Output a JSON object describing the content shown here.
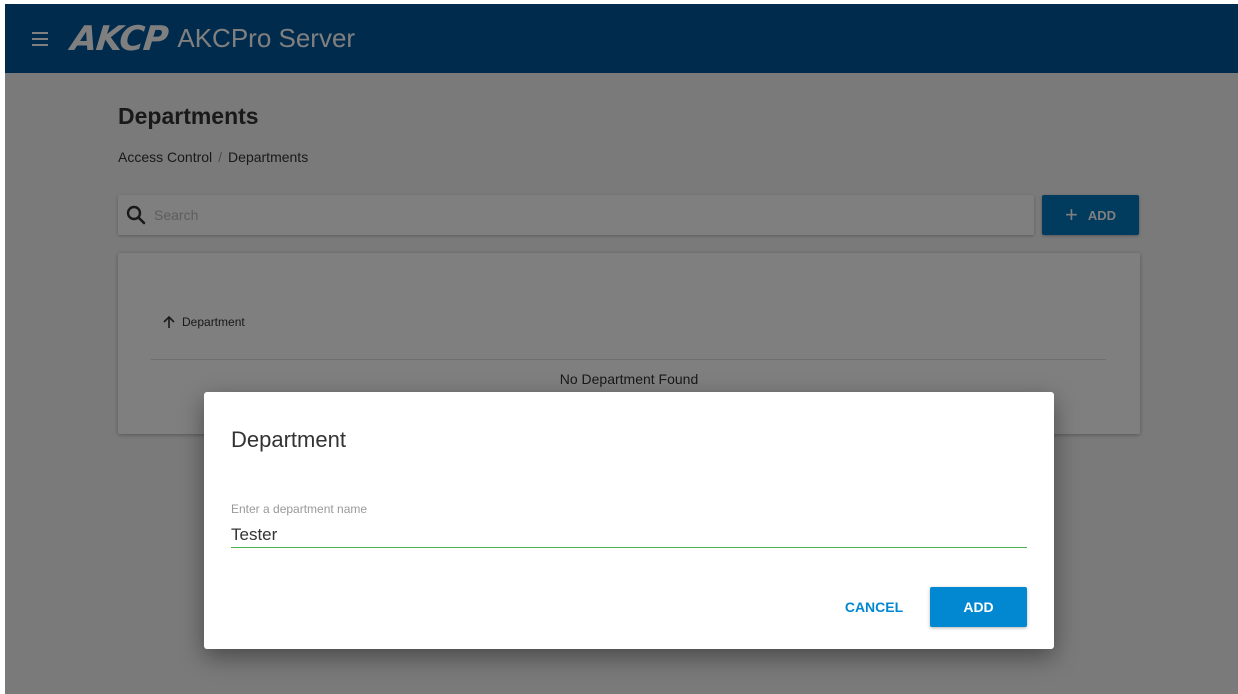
{
  "header": {
    "logo_text": "AKCP",
    "app_title": "AKCPro Server",
    "menu_icon": "hamburger-menu-icon",
    "bar_color": "#01579b"
  },
  "page": {
    "title": "Departments",
    "breadcrumb": [
      {
        "label": "Access Control"
      },
      {
        "separator": "/"
      },
      {
        "label": "Departments"
      }
    ]
  },
  "search": {
    "placeholder": "Search",
    "value": "",
    "icon": "search-icon"
  },
  "toolbar": {
    "add_label": "ADD",
    "add_icon": "plus-icon"
  },
  "table": {
    "columns": [
      {
        "label": "Department",
        "sort": "ascending",
        "sort_icon": "arrow-up-icon"
      }
    ],
    "empty_message": "No Department Found"
  },
  "dialog": {
    "title": "Department",
    "field_label": "Enter a department name",
    "field_value": "Tester",
    "cancel_label": "CANCEL",
    "add_label": "ADD",
    "accent_color": "#0288d1",
    "focus_color": "#4caf50"
  }
}
